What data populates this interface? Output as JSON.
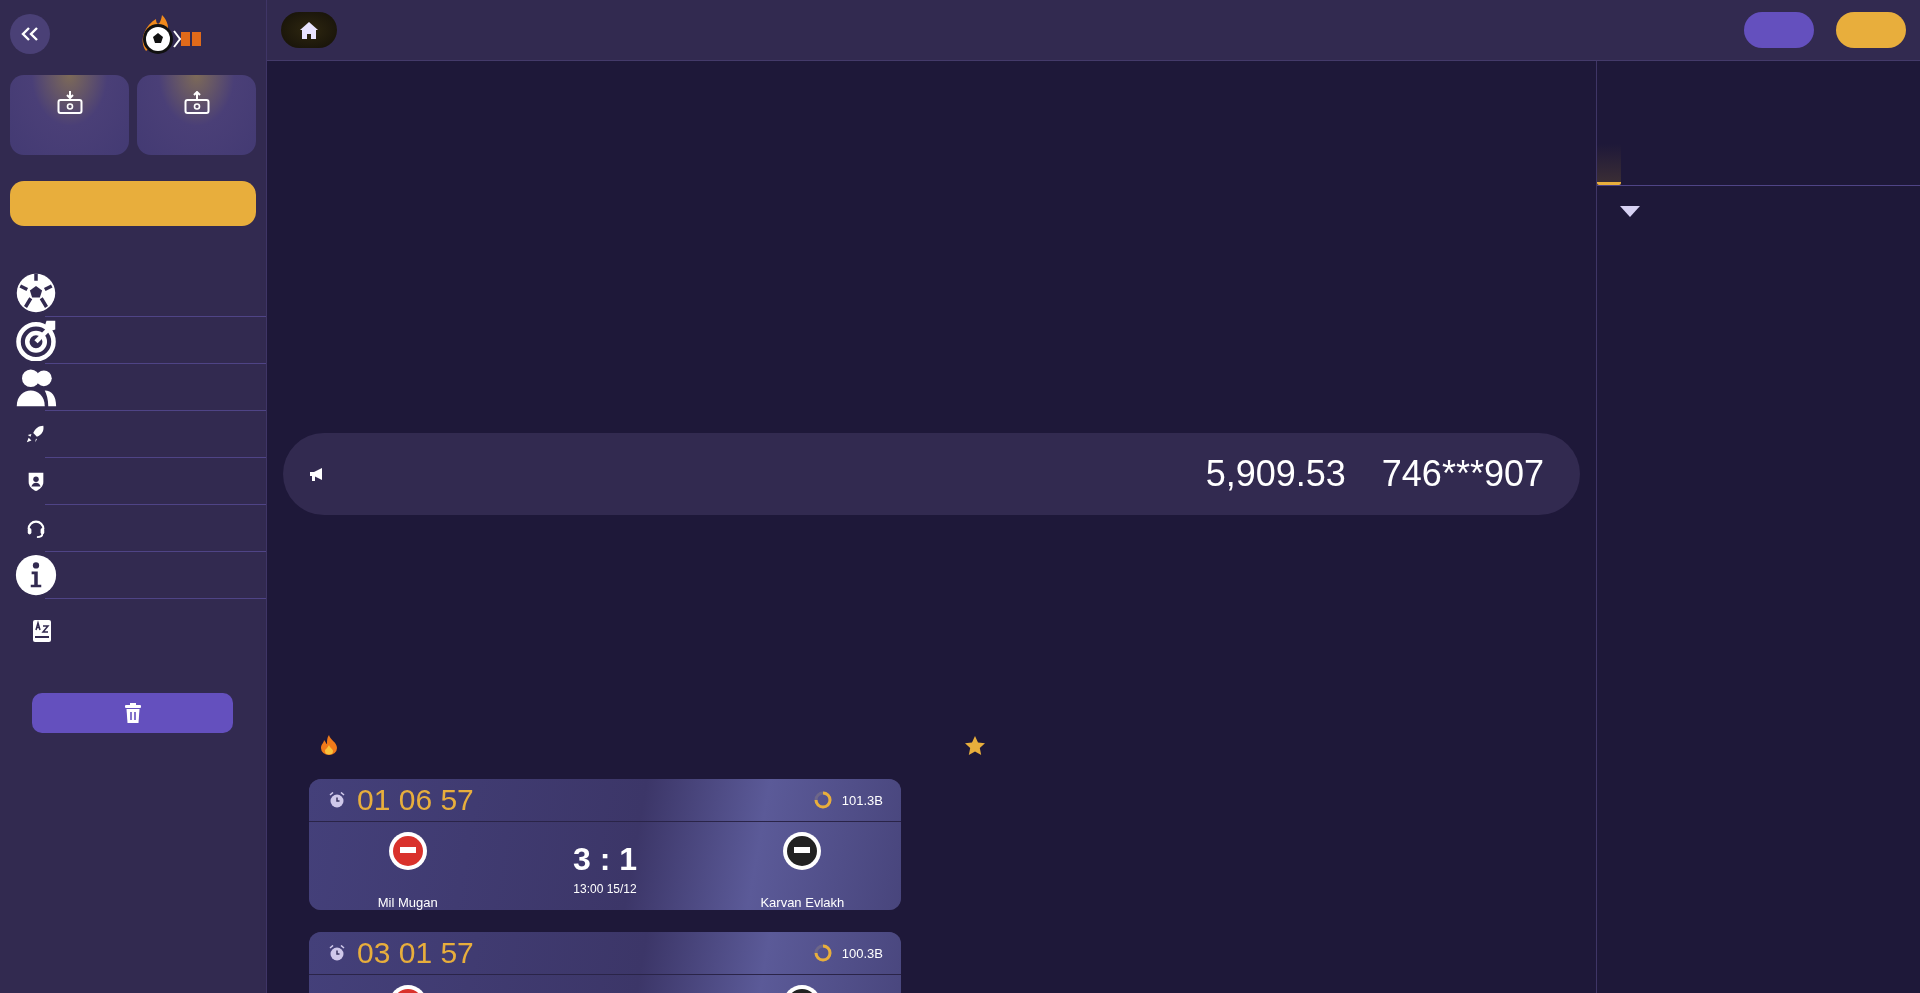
{
  "ticker": {
    "amount": "5,909.53",
    "user": "746***907"
  },
  "matches": [
    {
      "countdown": "01 06 57",
      "volume": "101.3B",
      "home": "Mil Mugan",
      "away": "Karvan Evlakh",
      "score": "3 : 1",
      "kickoff": "13:00 15/12"
    },
    {
      "countdown": "03 01 57",
      "volume": "100.3B"
    }
  ]
}
